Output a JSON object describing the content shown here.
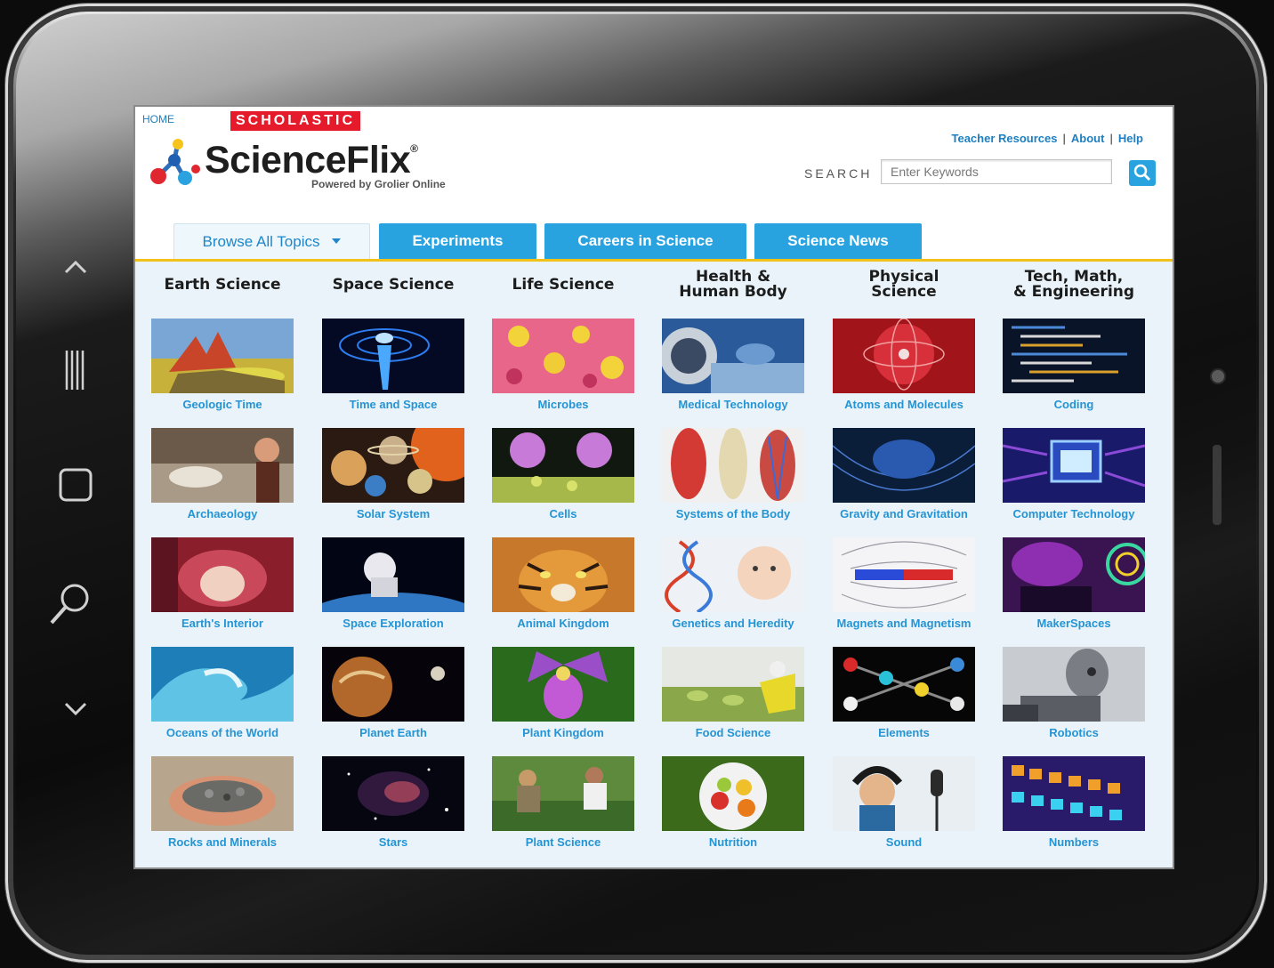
{
  "header": {
    "home_label": "HOME",
    "brand_badge": "SCHOLASTIC",
    "logo_text": "ScienceFlix",
    "logo_tagline": "Powered by Grolier Online",
    "links": [
      "Teacher Resources",
      "About",
      "Help"
    ],
    "search_label": "SEARCH",
    "search_placeholder": "Enter Keywords"
  },
  "nav": {
    "tabs": [
      {
        "label": "Browse All Topics",
        "active": true
      },
      {
        "label": "Experiments"
      },
      {
        "label": "Careers in Science"
      },
      {
        "label": "Science News"
      }
    ]
  },
  "colors": {
    "accent": "#29a3e0",
    "brand_red": "#e51a2a",
    "tab_rule": "#f2c21a",
    "caption": "#2594d4"
  },
  "columns": [
    {
      "title": [
        "Earth Science"
      ],
      "topics": [
        "Geologic Time",
        "Archaeology",
        "Earth's Interior",
        "Oceans of the World",
        "Rocks and Minerals"
      ]
    },
    {
      "title": [
        "Space Science"
      ],
      "topics": [
        "Time and Space",
        "Solar System",
        "Space Exploration",
        "Planet Earth",
        "Stars"
      ]
    },
    {
      "title": [
        "Life Science"
      ],
      "topics": [
        "Microbes",
        "Cells",
        "Animal Kingdom",
        "Plant Kingdom",
        "Plant Science"
      ]
    },
    {
      "title": [
        "Health &",
        "Human Body"
      ],
      "topics": [
        "Medical Technology",
        "Systems of the Body",
        "Genetics and Heredity",
        "Food Science",
        "Nutrition"
      ]
    },
    {
      "title": [
        "Physical",
        "Science"
      ],
      "topics": [
        "Atoms and Molecules",
        "Gravity and Gravitation",
        "Magnets and Magnetism",
        "Elements",
        "Sound"
      ]
    },
    {
      "title": [
        "Tech, Math,",
        "& Engineering"
      ],
      "topics": [
        "Coding",
        "Computer Technology",
        "MakerSpaces",
        "Robotics",
        "Numbers"
      ]
    }
  ]
}
